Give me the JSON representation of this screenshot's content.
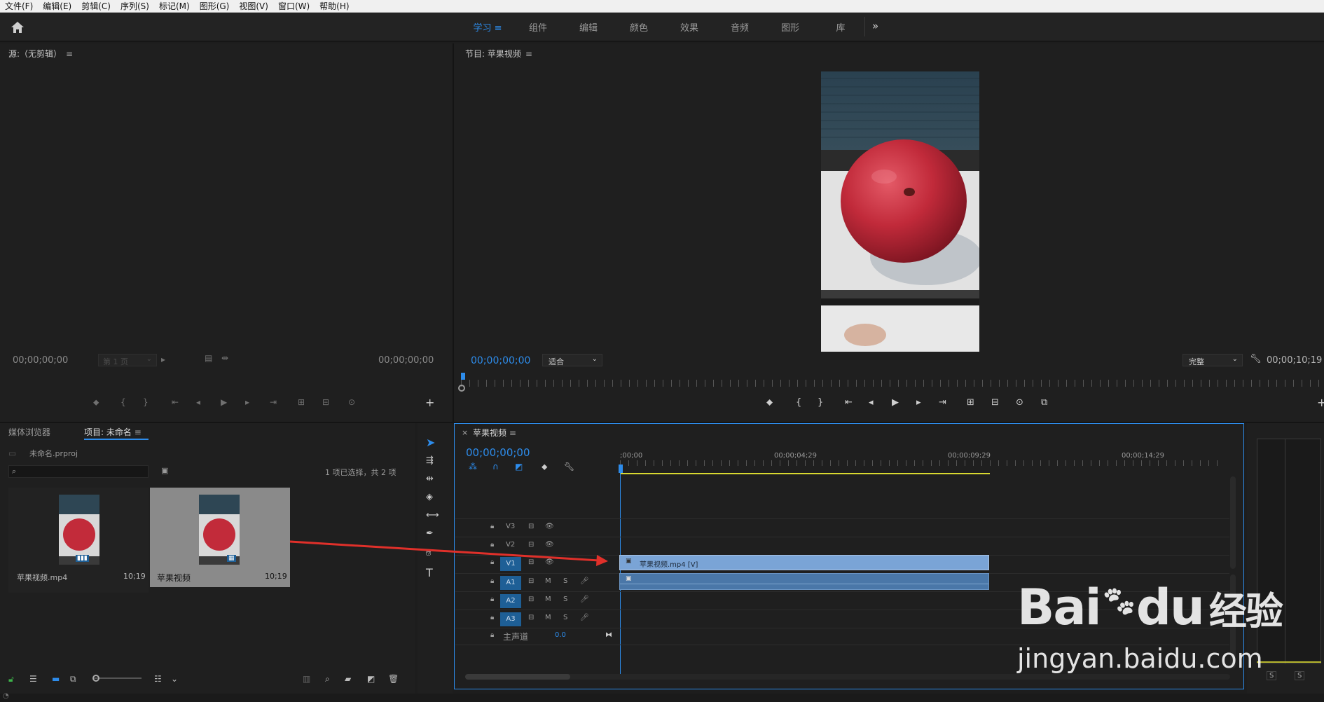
{
  "menu": [
    "文件(F)",
    "编辑(E)",
    "剪辑(C)",
    "序列(S)",
    "标记(M)",
    "图形(G)",
    "视图(V)",
    "窗口(W)",
    "帮助(H)"
  ],
  "workspaces": {
    "tabs": [
      "学习",
      "组件",
      "编辑",
      "颜色",
      "效果",
      "音频",
      "图形",
      "库"
    ],
    "active_index": 0,
    "more_label": "»"
  },
  "source_monitor": {
    "title": "源:（无剪辑）",
    "timecode_in": "00;00;00;00",
    "page_select": "第 1 页",
    "timecode_out": "00;00;00;00"
  },
  "program_monitor": {
    "title": "节目: 苹果视频",
    "timecode": "00;00;00;00",
    "fit_select": "适合",
    "quality_select": "完整",
    "duration": "00;00;10;19"
  },
  "project": {
    "tab_media": "媒体浏览器",
    "tab_project": "项目: 未命名",
    "file_name": "未命名.prproj",
    "selection_info": "1 项已选择，共 2 项",
    "items": [
      {
        "name": "苹果视频.mp4",
        "duration": "10;19",
        "selected": false
      },
      {
        "name": "苹果视频",
        "duration": "10;19",
        "selected": true
      }
    ]
  },
  "timeline": {
    "sequence_tab": "苹果视频",
    "close_label": "×",
    "timecode": "00;00;00;00",
    "ruler_labels": [
      ";00;00",
      "00;00;04;29",
      "00;00;09;29",
      "00;00;14;29"
    ],
    "video_tracks": [
      "V3",
      "V2",
      "V1"
    ],
    "audio_tracks": [
      "A1",
      "A2",
      "A3"
    ],
    "mute_label": "M",
    "solo_label": "S",
    "master_label": "主声道",
    "master_value": "0.0",
    "clip_video_label": "苹果视频.mp4 [V]"
  },
  "audio_meter": {
    "solo_left": "S",
    "solo_right": "S"
  },
  "watermark": {
    "brand": "Bai",
    "brand2": "du",
    "cn": "经验",
    "url": "jingyan.baidu.com"
  },
  "colors": {
    "accent": "#2d8ceb",
    "clip_video": "#7aa4d6",
    "clip_audio": "#4a77a8",
    "annotation_arrow": "#e0302a",
    "work_area": "#d8d830"
  }
}
